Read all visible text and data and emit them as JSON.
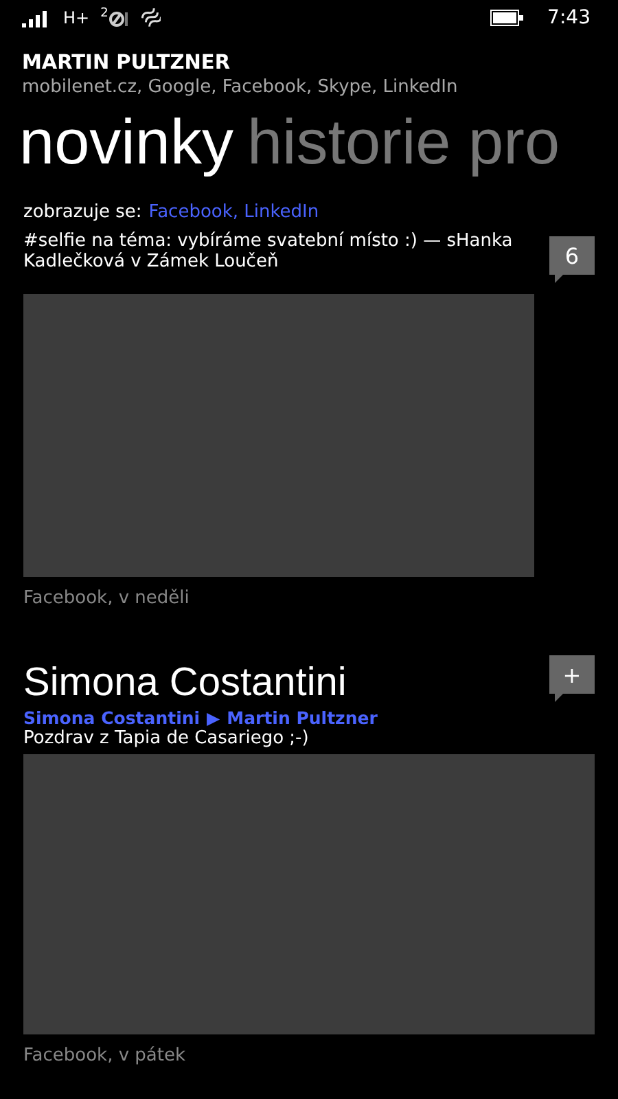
{
  "status_bar": {
    "network": "H+",
    "sim": "2",
    "time": "7:43"
  },
  "header": {
    "name": "MARTIN PULTZNER",
    "accounts": "mobilenet.cz, Google, Facebook, Skype, LinkedIn"
  },
  "pivots": [
    {
      "label": "novinky",
      "selected": true
    },
    {
      "label": "historie pro",
      "selected": false
    }
  ],
  "filter": {
    "label": "zobrazuje se:",
    "value": "Facebook, LinkedIn"
  },
  "posts": [
    {
      "kind": "status",
      "text": "#selfie na téma: vybíráme svatební místo :) — sHanka Kadlečková v Zámek Loučeň",
      "badge": "6",
      "footer": "Facebook, v neděli"
    },
    {
      "kind": "wall",
      "title": "Simona Costantini",
      "from": "Simona Costantini",
      "arrow": "▶",
      "to": "Martin Pultzner",
      "text": "Pozdrav z Tapia de Casariego ;-)",
      "badge": "+",
      "footer": "Facebook, v pátek"
    }
  ]
}
